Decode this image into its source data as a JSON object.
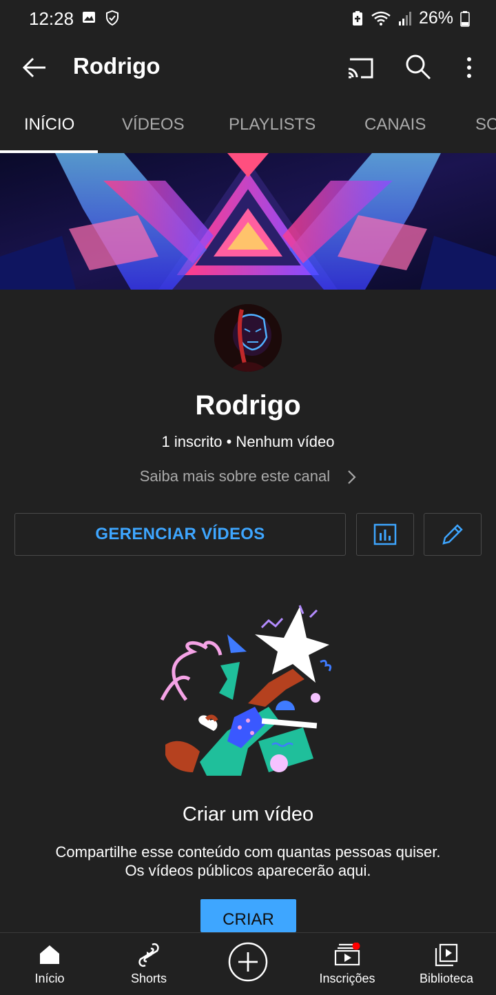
{
  "status_bar": {
    "time": "12:28",
    "battery": "26%",
    "icons_left": [
      "image-icon",
      "shield-icon"
    ],
    "icons_right": [
      "battery-saver-icon",
      "wifi-icon",
      "signal-icon",
      "battery-icon"
    ]
  },
  "app_bar": {
    "title": "Rodrigo",
    "icons": [
      "back-arrow-icon",
      "cast-icon",
      "search-icon",
      "more-vert-icon"
    ]
  },
  "tabs": [
    {
      "label": "INÍCIO",
      "active": true
    },
    {
      "label": "VÍDEOS",
      "active": false
    },
    {
      "label": "PLAYLISTS",
      "active": false
    },
    {
      "label": "CANAIS",
      "active": false
    },
    {
      "label": "SO",
      "active": false
    }
  ],
  "channel": {
    "name": "Rodrigo",
    "meta": "1 inscrito • Nenhum vídeo",
    "about_link": "Saiba mais sobre este canal"
  },
  "actions": {
    "manage_label": "GERENCIAR VÍDEOS",
    "icons": [
      "analytics-icon",
      "edit-pencil-icon"
    ]
  },
  "empty_state": {
    "title": "Criar um vídeo",
    "desc_line1": "Compartilhe esse conteúdo com quantas pessoas quiser.",
    "desc_line2": "Os vídeos públicos aparecerão aqui.",
    "button_label": "CRIAR"
  },
  "bottom_nav": [
    {
      "label": "Início",
      "icon": "home-icon"
    },
    {
      "label": "Shorts",
      "icon": "shorts-icon"
    },
    {
      "label": "",
      "icon": "create-plus-icon"
    },
    {
      "label": "Inscrições",
      "icon": "subscriptions-icon",
      "badge": true
    },
    {
      "label": "Biblioteca",
      "icon": "library-icon"
    }
  ],
  "colors": {
    "background": "#212121",
    "accent": "#3ea6ff",
    "notification": "#ff0000"
  }
}
